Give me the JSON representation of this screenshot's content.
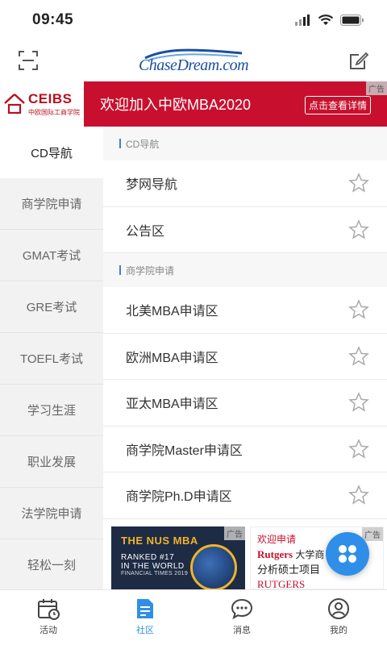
{
  "status": {
    "time": "09:45"
  },
  "header": {
    "logo_text": "ChaseDream.com"
  },
  "ad_banner": {
    "brand_en": "CEIBS",
    "brand_cn": "中欧国际工商学院",
    "headline": "欢迎加入中欧MBA2020",
    "cta": "点击查看详情",
    "tag": "广告"
  },
  "sidebar": {
    "items": [
      {
        "label": "CD导航",
        "active": true
      },
      {
        "label": "商学院申请"
      },
      {
        "label": "GMAT考试"
      },
      {
        "label": "GRE考试"
      },
      {
        "label": "TOEFL考试"
      },
      {
        "label": "学习生涯"
      },
      {
        "label": "职业发展"
      },
      {
        "label": "法学院申请"
      },
      {
        "label": "轻松一刻"
      }
    ]
  },
  "sections": [
    {
      "title": "CD导航",
      "rows": [
        {
          "label": "梦网导航"
        },
        {
          "label": "公告区"
        }
      ]
    },
    {
      "title": "商学院申请",
      "rows": [
        {
          "label": "北美MBA申请区"
        },
        {
          "label": "欧洲MBA申请区"
        },
        {
          "label": "亚太MBA申请区"
        },
        {
          "label": "商学院Master申请区"
        },
        {
          "label": "商学院Ph.D申请区"
        }
      ]
    }
  ],
  "ads": {
    "nus": {
      "line1": "THE NUS MBA",
      "line2": "RANKED #17",
      "line3": "IN THE WORLD",
      "line4": "FINANCIAL TIMES 2019",
      "tag": "广告"
    },
    "rutgers": {
      "line1": "欢迎申请",
      "brand": "Rutgers",
      "line2_rest": " 大学商",
      "line3": "分析硕士项目",
      "logo": "RUTGERS",
      "tag": "广告"
    }
  },
  "tabbar": {
    "tabs": [
      {
        "label": "活动",
        "icon": "calendar-icon"
      },
      {
        "label": "社区",
        "icon": "community-icon",
        "active": true
      },
      {
        "label": "消息",
        "icon": "message-icon"
      },
      {
        "label": "我的",
        "icon": "profile-icon"
      }
    ]
  },
  "colors": {
    "accent": "#2f8fe8",
    "ad_red": "#c8102e"
  }
}
